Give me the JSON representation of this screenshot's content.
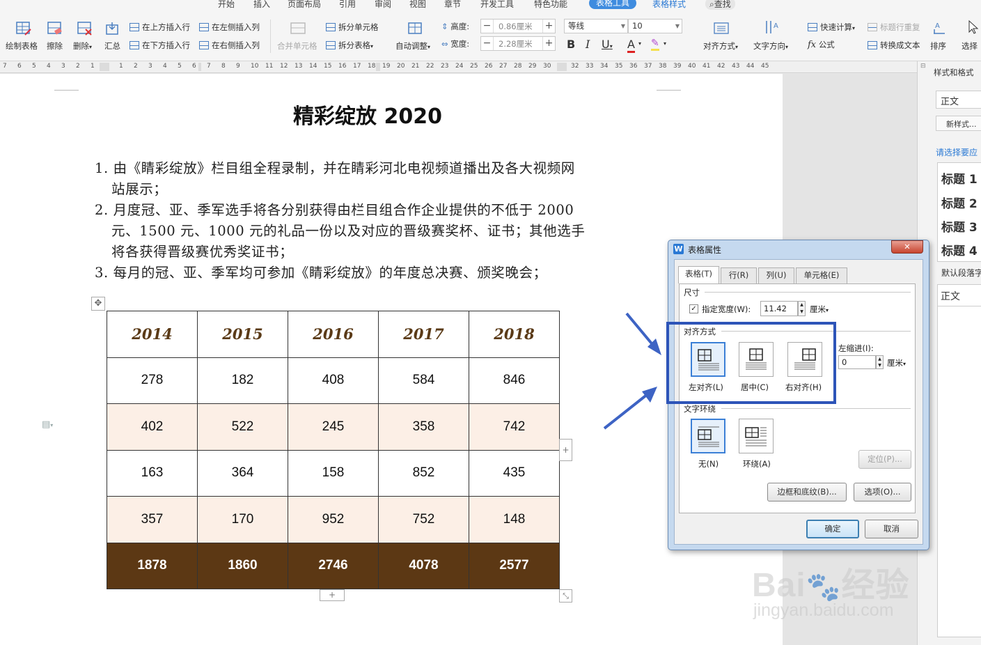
{
  "menu": [
    "开始",
    "插入",
    "页面布局",
    "引用",
    "审阅",
    "视图",
    "章节",
    "开发工具",
    "特色功能",
    "表格工具",
    "表格样式",
    "查找"
  ],
  "ribbon": {
    "draw_table": "绘制表格",
    "erase": "擦除",
    "delete": "删除",
    "summary": "汇总",
    "insert_above": "在上方插入行",
    "insert_below": "在下方插入行",
    "insert_left": "在左侧插入列",
    "insert_right": "在右侧插入列",
    "merge_cells": "合并单元格",
    "split_cells": "拆分单元格",
    "split_table": "拆分表格",
    "auto_fit": "自动调整",
    "height_label": "高度:",
    "height_value": "0.86厘米",
    "width_label": "宽度:",
    "width_value": "2.28厘米",
    "font_name": "等线",
    "font_size": "10",
    "align": "对齐方式",
    "text_dir": "文字方向",
    "quick_calc": "快速计算",
    "repeat_header": "标题行重复",
    "formula": "公式",
    "to_text": "转换成文本",
    "sort": "排序",
    "select": "选择"
  },
  "ruler_left": [
    "7",
    "6",
    "5",
    "4",
    "3",
    "2",
    "1"
  ],
  "ruler_mid": [
    "1",
    "2",
    "3",
    "4",
    "5",
    "6",
    "7",
    "8",
    "9",
    "10",
    "11",
    "12",
    "13",
    "14",
    "15",
    "16",
    "17",
    "18",
    "19",
    "20",
    "21",
    "22",
    "23",
    "24",
    "25",
    "26",
    "27",
    "28",
    "29",
    "30"
  ],
  "ruler_right": [
    "32",
    "33",
    "34",
    "35",
    "36",
    "37",
    "38",
    "39",
    "40",
    "41",
    "42",
    "43",
    "44",
    "45"
  ],
  "document": {
    "title": "精彩绽放 2020",
    "lines": [
      "1. 由《睛彩绽放》栏目组全程录制，并在睛彩河北电视频道播出及各大视频网",
      "站展示；",
      "2. 月度冠、亚、季军选手将各分别获得由栏目组合作企业提供的不低于 2000",
      "元、1500 元、1000 元的礼品一份以及对应的晋级赛奖杯、证书；其他选手",
      "将各获得晋级赛优秀奖证书；",
      "3. 每月的冠、亚、季军均可参加《睛彩绽放》的年度总决赛、颁奖晚会；"
    ]
  },
  "table": {
    "header": [
      "2014",
      "2015",
      "2016",
      "2017",
      "2018"
    ],
    "rows": [
      [
        "278",
        "182",
        "408",
        "584",
        "846"
      ],
      [
        "402",
        "522",
        "245",
        "358",
        "742"
      ],
      [
        "163",
        "364",
        "158",
        "852",
        "435"
      ],
      [
        "357",
        "170",
        "952",
        "752",
        "148"
      ]
    ],
    "total": [
      "1878",
      "1860",
      "2746",
      "4078",
      "2577"
    ]
  },
  "panel": {
    "title": "样式和格式",
    "current_style": "正文",
    "new_style": "新样式...",
    "prompt": "请选择要应",
    "styles": [
      "标题 1",
      "标题 2",
      "标题 3",
      "标题 4"
    ],
    "default_para": "默认段落字",
    "body_style": "正文"
  },
  "dialog": {
    "title": "表格属性",
    "tabs": [
      "表格(T)",
      "行(R)",
      "列(U)",
      "单元格(E)"
    ],
    "size_group": "尺寸",
    "specify_width": "指定宽度(W):",
    "width_value": "11.42",
    "unit": "厘米",
    "align_group": "对齐方式",
    "align_left": "左对齐(L)",
    "align_center": "居中(C)",
    "align_right": "右对齐(H)",
    "indent_label": "左缩进(I):",
    "indent_value": "0",
    "wrap_group": "文字环绕",
    "wrap_none": "无(N)",
    "wrap_around": "环绕(A)",
    "position": "定位(P)...",
    "borders": "边框和底纹(B)...",
    "options": "选项(O)...",
    "ok": "确定",
    "cancel": "取消"
  },
  "watermark": {
    "brand": "Bai",
    "brand2": "经验",
    "url": "jingyan.baidu.com"
  },
  "colors": {
    "accent": "#3f8cdf",
    "highlight": "#2d54b8",
    "table_total": "#5c3814",
    "table_shade": "#fcefe6"
  }
}
